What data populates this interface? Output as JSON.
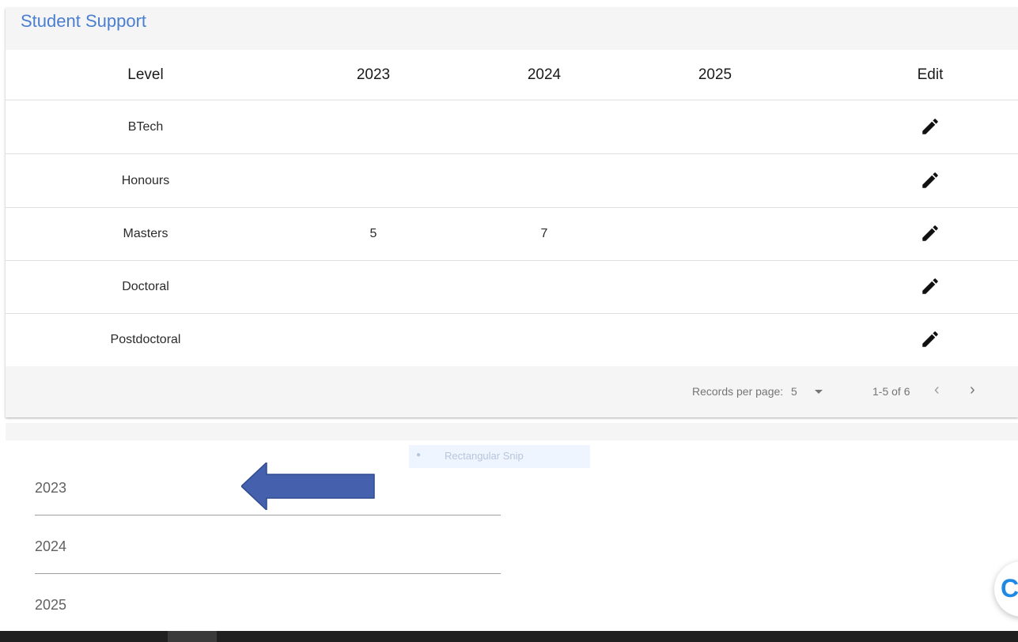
{
  "card": {
    "title": "Student Support",
    "columns": [
      "Level",
      "2023",
      "2024",
      "2025",
      "Edit"
    ],
    "rows": [
      {
        "level": "BTech",
        "y2023": "",
        "y2024": "",
        "y2025": ""
      },
      {
        "level": "Honours",
        "y2023": "",
        "y2024": "",
        "y2025": ""
      },
      {
        "level": "Masters",
        "y2023": "5",
        "y2024": "7",
        "y2025": ""
      },
      {
        "level": "Doctoral",
        "y2023": "",
        "y2024": "",
        "y2025": ""
      },
      {
        "level": "Postdoctoral",
        "y2023": "",
        "y2024": "",
        "y2025": ""
      }
    ],
    "edit_icon": "pencil-icon",
    "pagination": {
      "records_per_page_label": "Records per page:",
      "records_per_page_value": "5",
      "range": "1-5 of 6",
      "prev_icon": "chevron-left-icon",
      "next_icon": "chevron-right-icon"
    }
  },
  "snip": {
    "label": "Rectangular Snip"
  },
  "year_list": [
    "2023",
    "2024",
    "2025"
  ],
  "annotation": {
    "arrow_color": "#4561ae",
    "arrow_direction": "left"
  },
  "chat": {
    "glyph": "C"
  },
  "colors": {
    "title": "#4a7fd0",
    "header_bg": "#f5f5f5"
  }
}
